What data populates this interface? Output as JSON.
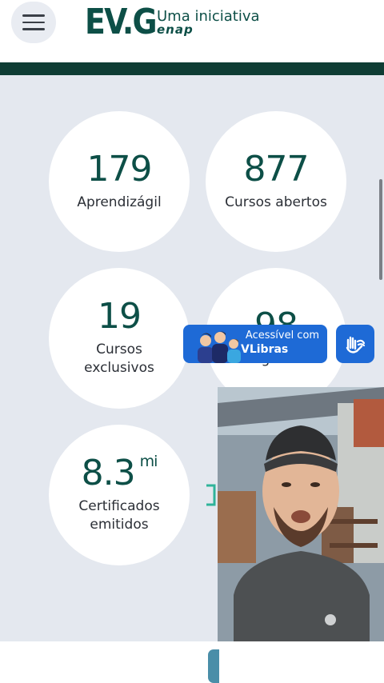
{
  "header": {
    "logo_mark": "EV.G",
    "logo_tagline": "Uma iniciativa",
    "logo_enap": "enap"
  },
  "stats": [
    {
      "number": "179",
      "suffix": "",
      "label": "Aprendizágil"
    },
    {
      "number": "877",
      "suffix": "",
      "label": "Cursos abertos"
    },
    {
      "number": "19",
      "suffix": "",
      "label": "Cursos\nexclusivos"
    },
    {
      "number": "98",
      "suffix": "",
      "label": "Programas"
    },
    {
      "number": "8.3",
      "suffix": "mi",
      "label": "Certificados\nemitidos"
    }
  ],
  "vlibras": {
    "line1": "Acessível com",
    "line2": "VLibras"
  },
  "icons": {
    "menu": "hamburger-menu-icon",
    "accessibility": "sign-language-hands-icon",
    "avatars": "vlibras-avatars-icon"
  },
  "colors": {
    "brand": "#0d4f47",
    "bar": "#0f3d34",
    "background": "#e4e8ef",
    "vlibras_blue": "#1e6ad6"
  }
}
